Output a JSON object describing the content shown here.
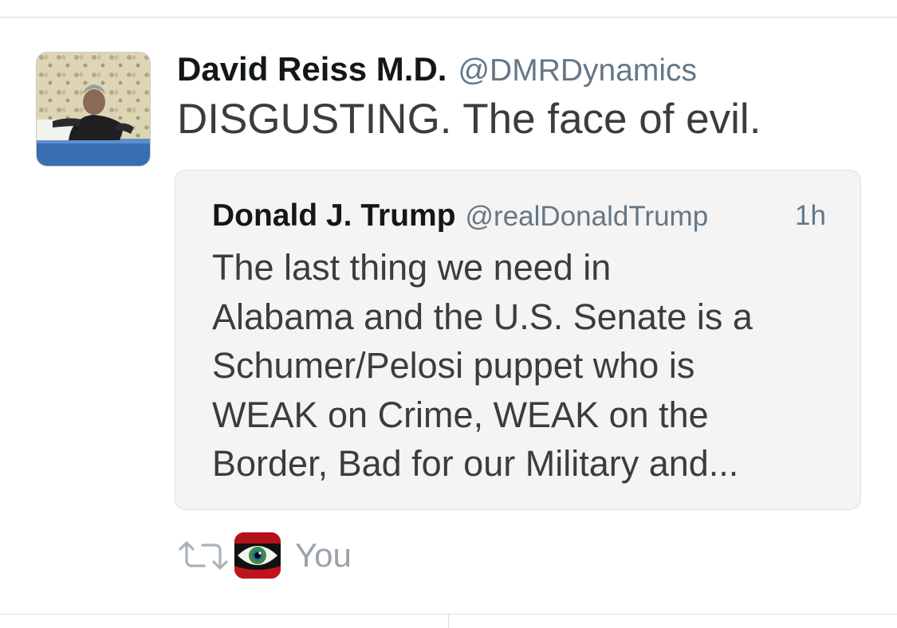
{
  "tweet": {
    "author_name": "David Reiss M.D.",
    "author_handle": "@DMRDynamics",
    "text": "DISGUSTING. The face of evil.",
    "avatar_icon": "profile-photo"
  },
  "quoted_tweet": {
    "author_name": "Donald J. Trump",
    "author_handle": "@realDonaldTrump",
    "time": "1h",
    "text": "The last thing we need in\nAlabama and the U.S. Senate is a\nSchumer/Pelosi puppet who is\nWEAK on Crime, WEAK on the\nBorder, Bad for our Military and..."
  },
  "retweet_context": {
    "icon": "retweet-icon",
    "avatar_icon": "eye-avatar",
    "label": "You"
  },
  "colors": {
    "name_text": "#14171a",
    "handle_text": "#657786",
    "body_text": "#3a3d40",
    "quote_background": "#f4f4f4",
    "muted_label": "#9aa3ab"
  }
}
